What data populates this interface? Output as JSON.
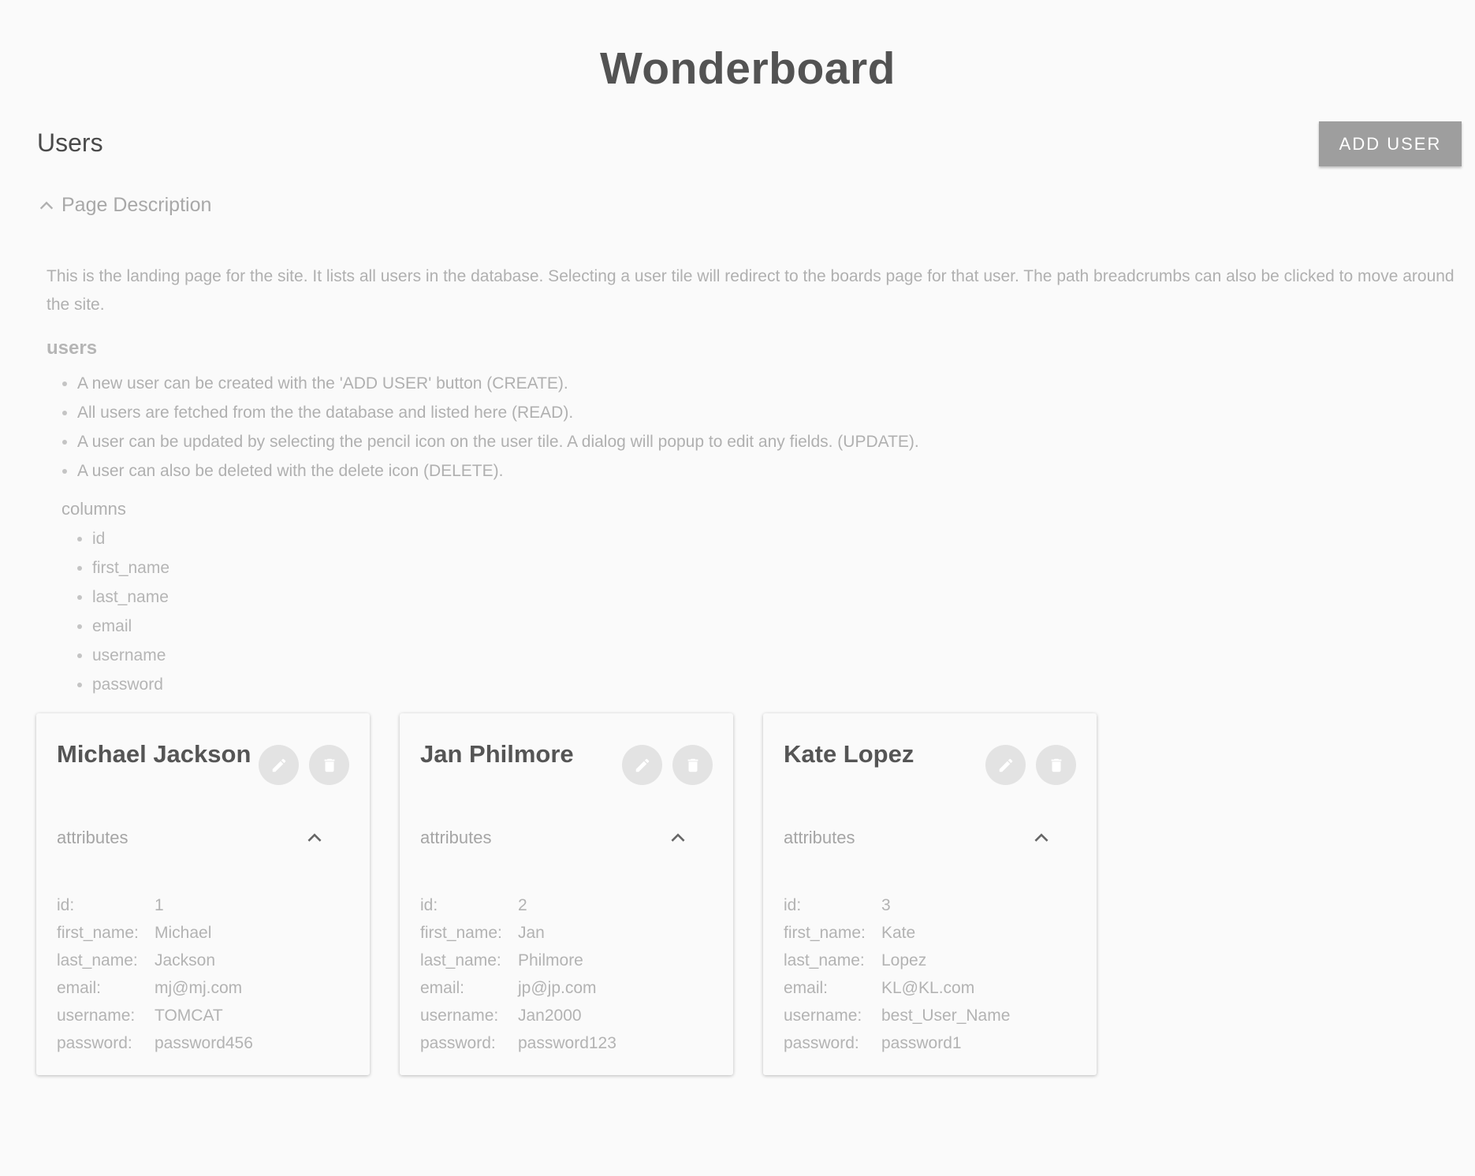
{
  "app": {
    "title": "Wonderboard"
  },
  "page": {
    "heading": "Users",
    "add_button": "ADD USER",
    "description_toggle": "Page Description",
    "description": "This is the landing page for the site. It lists all users in the database. Selecting a user tile will redirect to the boards page for that user. The path breadcrumbs can also be clicked to move around the site.",
    "users_heading": "users",
    "operations": [
      "A new user can be created with the 'ADD USER' button (CREATE).",
      "All users are fetched from the the database and listed here (READ).",
      "A user can be updated by selecting the pencil icon on the user tile. A dialog will popup to edit any fields. (UPDATE).",
      "A user can also be deleted with the delete icon (DELETE)."
    ],
    "columns_heading": "columns",
    "columns": [
      "id",
      "first_name",
      "last_name",
      "email",
      "username",
      "password"
    ]
  },
  "cards": [
    {
      "name": "Michael Jackson",
      "attributes_label": "attributes",
      "fields": [
        {
          "key": "id:",
          "value": "1"
        },
        {
          "key": "first_name:",
          "value": "Michael"
        },
        {
          "key": "last_name:",
          "value": "Jackson"
        },
        {
          "key": "email:",
          "value": "mj@mj.com"
        },
        {
          "key": "username:",
          "value": "TOMCAT"
        },
        {
          "key": "password:",
          "value": "password456"
        }
      ]
    },
    {
      "name": "Jan Philmore",
      "attributes_label": "attributes",
      "fields": [
        {
          "key": "id:",
          "value": "2"
        },
        {
          "key": "first_name:",
          "value": "Jan"
        },
        {
          "key": "last_name:",
          "value": "Philmore"
        },
        {
          "key": "email:",
          "value": "jp@jp.com"
        },
        {
          "key": "username:",
          "value": "Jan2000"
        },
        {
          "key": "password:",
          "value": "password123"
        }
      ]
    },
    {
      "name": "Kate Lopez",
      "attributes_label": "attributes",
      "fields": [
        {
          "key": "id:",
          "value": "3"
        },
        {
          "key": "first_name:",
          "value": "Kate"
        },
        {
          "key": "last_name:",
          "value": "Lopez"
        },
        {
          "key": "email:",
          "value": "KL@KL.com"
        },
        {
          "key": "username:",
          "value": "best_User_Name"
        },
        {
          "key": "password:",
          "value": "password1"
        }
      ]
    }
  ],
  "icons": {
    "collapse": "chevron-up-icon",
    "edit": "pencil-icon",
    "delete": "trash-icon"
  },
  "colors": {
    "background": "#fafafa",
    "button": "#9e9e9e",
    "icon_button": "#e3e3e3"
  }
}
